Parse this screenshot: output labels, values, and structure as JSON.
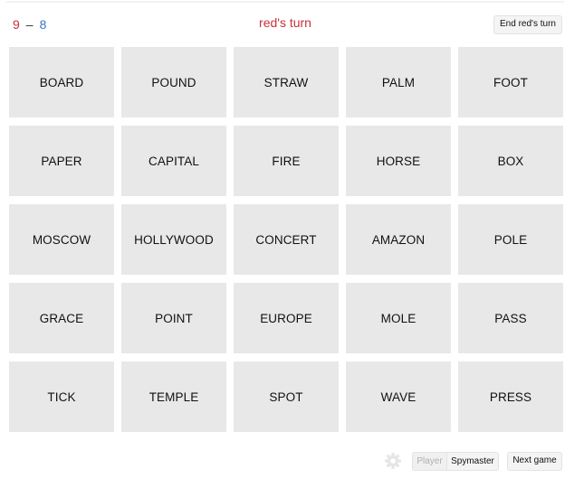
{
  "header": {
    "score_red": "9",
    "score_dash": "–",
    "score_blue": "8",
    "turn_label": "red's turn",
    "end_turn_label": "End red's turn"
  },
  "colors": {
    "red": "#c8313a",
    "blue": "#3a74c8",
    "card_bg": "#e8e8e8"
  },
  "board": {
    "cards": [
      "BOARD",
      "POUND",
      "STRAW",
      "PALM",
      "FOOT",
      "PAPER",
      "CAPITAL",
      "FIRE",
      "HORSE",
      "BOX",
      "MOSCOW",
      "HOLLYWOOD",
      "CONCERT",
      "AMAZON",
      "POLE",
      "GRACE",
      "POINT",
      "EUROPE",
      "MOLE",
      "PASS",
      "TICK",
      "TEMPLE",
      "SPOT",
      "WAVE",
      "PRESS"
    ]
  },
  "footer": {
    "settings_icon": "gear-icon",
    "role_options": [
      "Player",
      "Spymaster"
    ],
    "selected_role": "Spymaster",
    "next_game_label": "Next game"
  }
}
